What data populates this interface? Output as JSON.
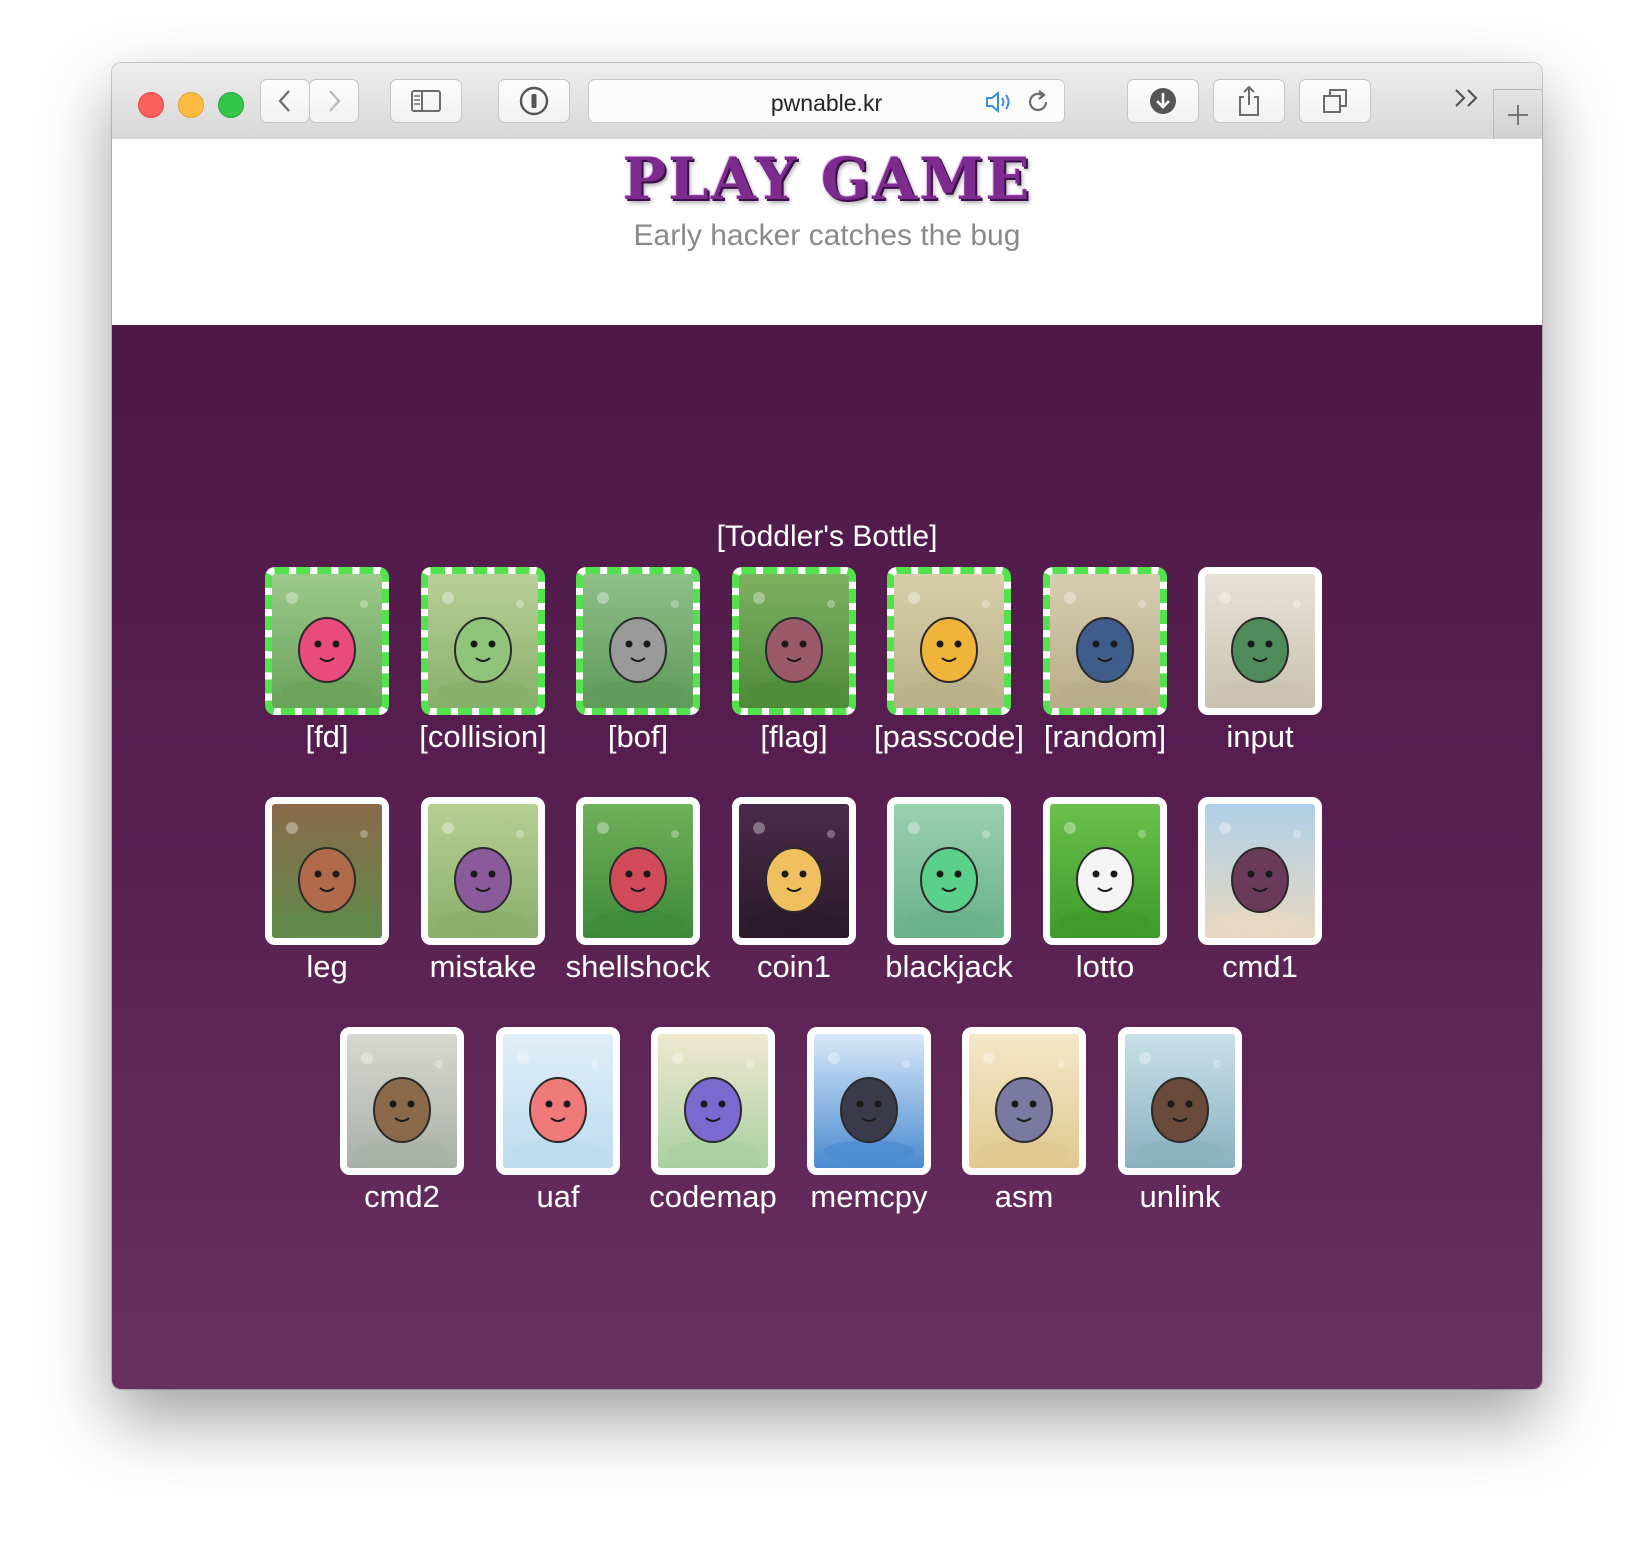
{
  "browser": {
    "url": "pwnable.kr"
  },
  "header": {
    "logo_text": "PLAY GAME",
    "tagline": "Early hacker catches the bug"
  },
  "section": {
    "title": "[Toddler's Bottle]"
  },
  "challenges": [
    {
      "label": "[fd]",
      "solved": true,
      "art": "pink-slime"
    },
    {
      "label": "[collision]",
      "solved": true,
      "art": "green-caterpillars"
    },
    {
      "label": "[bof]",
      "solved": true,
      "art": "raccoon"
    },
    {
      "label": "[flag]",
      "solved": true,
      "art": "cocoon"
    },
    {
      "label": "[passcode]",
      "solved": true,
      "art": "yellow-bird"
    },
    {
      "label": "[random]",
      "solved": true,
      "art": "blue-wolf"
    },
    {
      "label": "input",
      "solved": false,
      "art": "boxing-bug"
    },
    {
      "label": "leg",
      "solved": false,
      "art": "brown-bear"
    },
    {
      "label": "mistake",
      "solved": false,
      "art": "monkey"
    },
    {
      "label": "shellshock",
      "solved": false,
      "art": "shell-monster"
    },
    {
      "label": "coin1",
      "solved": false,
      "art": "ghost-lantern"
    },
    {
      "label": "blackjack",
      "solved": false,
      "art": "green-lizard"
    },
    {
      "label": "lotto",
      "solved": false,
      "art": "white-rabbit"
    },
    {
      "label": "cmd1",
      "solved": false,
      "art": "girl-shell"
    },
    {
      "label": "cmd2",
      "solved": false,
      "art": "hooded-creature"
    },
    {
      "label": "uaf",
      "solved": false,
      "art": "clouds"
    },
    {
      "label": "codemap",
      "solved": false,
      "art": "sleeping-creatures"
    },
    {
      "label": "memcpy",
      "solved": false,
      "art": "cat-umbrella"
    },
    {
      "label": "asm",
      "solved": false,
      "art": "goggle-bird"
    },
    {
      "label": "unlink",
      "solved": false,
      "art": "brown-beetle"
    }
  ]
}
